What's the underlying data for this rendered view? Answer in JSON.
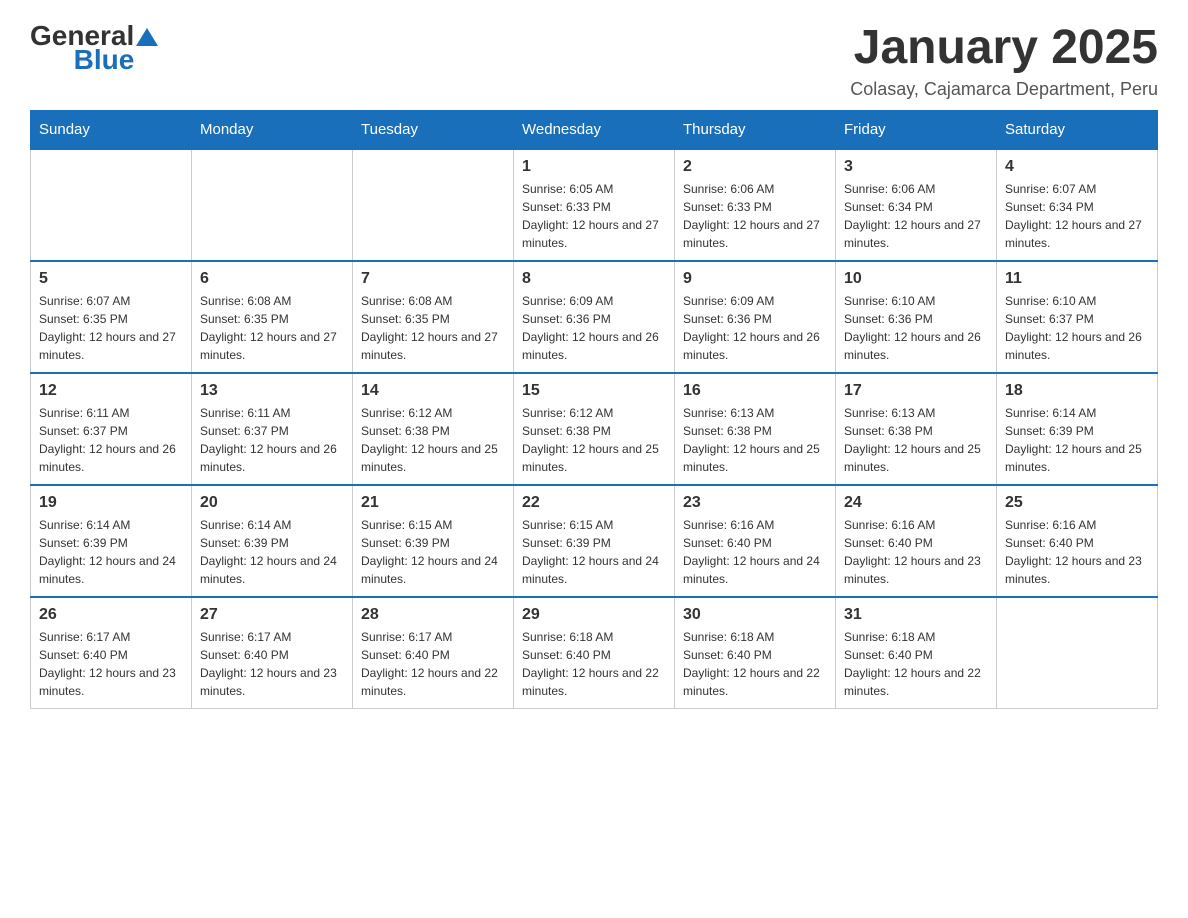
{
  "header": {
    "logo_general": "General",
    "logo_blue": "Blue",
    "month_title": "January 2025",
    "subtitle": "Colasay, Cajamarca Department, Peru"
  },
  "weekdays": [
    "Sunday",
    "Monday",
    "Tuesday",
    "Wednesday",
    "Thursday",
    "Friday",
    "Saturday"
  ],
  "weeks": [
    [
      {
        "day": "",
        "info": ""
      },
      {
        "day": "",
        "info": ""
      },
      {
        "day": "",
        "info": ""
      },
      {
        "day": "1",
        "info": "Sunrise: 6:05 AM\nSunset: 6:33 PM\nDaylight: 12 hours and 27 minutes."
      },
      {
        "day": "2",
        "info": "Sunrise: 6:06 AM\nSunset: 6:33 PM\nDaylight: 12 hours and 27 minutes."
      },
      {
        "day": "3",
        "info": "Sunrise: 6:06 AM\nSunset: 6:34 PM\nDaylight: 12 hours and 27 minutes."
      },
      {
        "day": "4",
        "info": "Sunrise: 6:07 AM\nSunset: 6:34 PM\nDaylight: 12 hours and 27 minutes."
      }
    ],
    [
      {
        "day": "5",
        "info": "Sunrise: 6:07 AM\nSunset: 6:35 PM\nDaylight: 12 hours and 27 minutes."
      },
      {
        "day": "6",
        "info": "Sunrise: 6:08 AM\nSunset: 6:35 PM\nDaylight: 12 hours and 27 minutes."
      },
      {
        "day": "7",
        "info": "Sunrise: 6:08 AM\nSunset: 6:35 PM\nDaylight: 12 hours and 27 minutes."
      },
      {
        "day": "8",
        "info": "Sunrise: 6:09 AM\nSunset: 6:36 PM\nDaylight: 12 hours and 26 minutes."
      },
      {
        "day": "9",
        "info": "Sunrise: 6:09 AM\nSunset: 6:36 PM\nDaylight: 12 hours and 26 minutes."
      },
      {
        "day": "10",
        "info": "Sunrise: 6:10 AM\nSunset: 6:36 PM\nDaylight: 12 hours and 26 minutes."
      },
      {
        "day": "11",
        "info": "Sunrise: 6:10 AM\nSunset: 6:37 PM\nDaylight: 12 hours and 26 minutes."
      }
    ],
    [
      {
        "day": "12",
        "info": "Sunrise: 6:11 AM\nSunset: 6:37 PM\nDaylight: 12 hours and 26 minutes."
      },
      {
        "day": "13",
        "info": "Sunrise: 6:11 AM\nSunset: 6:37 PM\nDaylight: 12 hours and 26 minutes."
      },
      {
        "day": "14",
        "info": "Sunrise: 6:12 AM\nSunset: 6:38 PM\nDaylight: 12 hours and 25 minutes."
      },
      {
        "day": "15",
        "info": "Sunrise: 6:12 AM\nSunset: 6:38 PM\nDaylight: 12 hours and 25 minutes."
      },
      {
        "day": "16",
        "info": "Sunrise: 6:13 AM\nSunset: 6:38 PM\nDaylight: 12 hours and 25 minutes."
      },
      {
        "day": "17",
        "info": "Sunrise: 6:13 AM\nSunset: 6:38 PM\nDaylight: 12 hours and 25 minutes."
      },
      {
        "day": "18",
        "info": "Sunrise: 6:14 AM\nSunset: 6:39 PM\nDaylight: 12 hours and 25 minutes."
      }
    ],
    [
      {
        "day": "19",
        "info": "Sunrise: 6:14 AM\nSunset: 6:39 PM\nDaylight: 12 hours and 24 minutes."
      },
      {
        "day": "20",
        "info": "Sunrise: 6:14 AM\nSunset: 6:39 PM\nDaylight: 12 hours and 24 minutes."
      },
      {
        "day": "21",
        "info": "Sunrise: 6:15 AM\nSunset: 6:39 PM\nDaylight: 12 hours and 24 minutes."
      },
      {
        "day": "22",
        "info": "Sunrise: 6:15 AM\nSunset: 6:39 PM\nDaylight: 12 hours and 24 minutes."
      },
      {
        "day": "23",
        "info": "Sunrise: 6:16 AM\nSunset: 6:40 PM\nDaylight: 12 hours and 24 minutes."
      },
      {
        "day": "24",
        "info": "Sunrise: 6:16 AM\nSunset: 6:40 PM\nDaylight: 12 hours and 23 minutes."
      },
      {
        "day": "25",
        "info": "Sunrise: 6:16 AM\nSunset: 6:40 PM\nDaylight: 12 hours and 23 minutes."
      }
    ],
    [
      {
        "day": "26",
        "info": "Sunrise: 6:17 AM\nSunset: 6:40 PM\nDaylight: 12 hours and 23 minutes."
      },
      {
        "day": "27",
        "info": "Sunrise: 6:17 AM\nSunset: 6:40 PM\nDaylight: 12 hours and 23 minutes."
      },
      {
        "day": "28",
        "info": "Sunrise: 6:17 AM\nSunset: 6:40 PM\nDaylight: 12 hours and 22 minutes."
      },
      {
        "day": "29",
        "info": "Sunrise: 6:18 AM\nSunset: 6:40 PM\nDaylight: 12 hours and 22 minutes."
      },
      {
        "day": "30",
        "info": "Sunrise: 6:18 AM\nSunset: 6:40 PM\nDaylight: 12 hours and 22 minutes."
      },
      {
        "day": "31",
        "info": "Sunrise: 6:18 AM\nSunset: 6:40 PM\nDaylight: 12 hours and 22 minutes."
      },
      {
        "day": "",
        "info": ""
      }
    ]
  ]
}
